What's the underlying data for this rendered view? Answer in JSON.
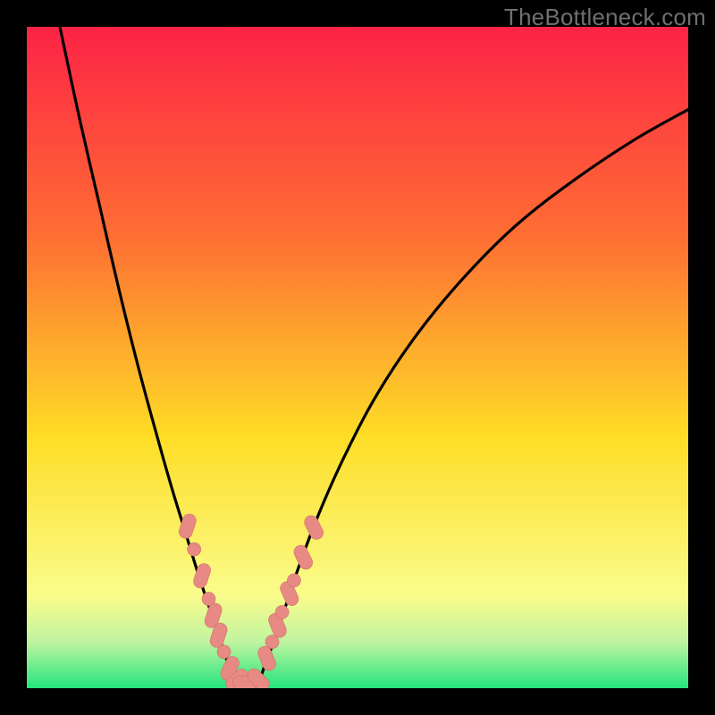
{
  "watermark": "TheBottleneck.com",
  "colors": {
    "gradient_top": "#fd2346",
    "gradient_mid1": "#fe6f33",
    "gradient_mid2": "#fedd26",
    "gradient_mid3": "#fafc8b",
    "gradient_mid4": "#c0f4a0",
    "gradient_bottom": "#23e57d",
    "curve": "#000000",
    "marker_fill": "#e78a83",
    "marker_stroke": "#d06f69"
  },
  "chart_data": {
    "type": "line",
    "title": "",
    "xlabel": "",
    "ylabel": "",
    "xlim": [
      0,
      100
    ],
    "ylim": [
      0,
      100
    ],
    "series": [
      {
        "name": "left-branch",
        "x": [
          5,
          8,
          11,
          14,
          17,
          20,
          22,
          24,
          26,
          28,
          29.5,
          30.5,
          31.5
        ],
        "y": [
          100,
          86,
          73,
          60,
          48,
          37,
          30,
          23.5,
          17,
          11,
          6.5,
          3.5,
          1.2
        ]
      },
      {
        "name": "right-branch",
        "x": [
          35,
          36,
          37.5,
          39,
          41,
          44,
          48,
          53,
          59,
          66,
          74,
          83,
          92,
          100
        ],
        "y": [
          1.2,
          3.5,
          7.5,
          12,
          18,
          26,
          35,
          44.5,
          53.5,
          62,
          70,
          77,
          83,
          87.5
        ]
      },
      {
        "name": "valley-floor",
        "x": [
          31.5,
          33,
          35
        ],
        "y": [
          1.2,
          0.8,
          1.2
        ]
      }
    ],
    "markers_left": [
      {
        "x": 24.3,
        "y": 24.5,
        "shape": "capsule",
        "angle": -72
      },
      {
        "x": 25.3,
        "y": 21.0,
        "shape": "dot"
      },
      {
        "x": 26.5,
        "y": 17.0,
        "shape": "capsule",
        "angle": -72
      },
      {
        "x": 27.5,
        "y": 13.5,
        "shape": "dot"
      },
      {
        "x": 28.2,
        "y": 11.0,
        "shape": "capsule",
        "angle": -72
      },
      {
        "x": 29.0,
        "y": 8.0,
        "shape": "capsule",
        "angle": -72
      },
      {
        "x": 29.8,
        "y": 5.5,
        "shape": "dot"
      },
      {
        "x": 30.7,
        "y": 3.0,
        "shape": "capsule",
        "angle": -65
      },
      {
        "x": 31.8,
        "y": 1.3,
        "shape": "capsule",
        "angle": -40
      }
    ],
    "markers_right": [
      {
        "x": 35.0,
        "y": 1.3,
        "shape": "capsule",
        "angle": 45
      },
      {
        "x": 36.3,
        "y": 4.5,
        "shape": "capsule",
        "angle": 68
      },
      {
        "x": 37.1,
        "y": 7.0,
        "shape": "dot"
      },
      {
        "x": 37.9,
        "y": 9.5,
        "shape": "capsule",
        "angle": 68
      },
      {
        "x": 38.6,
        "y": 11.5,
        "shape": "dot"
      },
      {
        "x": 39.7,
        "y": 14.3,
        "shape": "capsule",
        "angle": 66
      },
      {
        "x": 40.4,
        "y": 16.3,
        "shape": "dot"
      },
      {
        "x": 41.8,
        "y": 19.8,
        "shape": "capsule",
        "angle": 64
      },
      {
        "x": 43.4,
        "y": 24.3,
        "shape": "capsule",
        "angle": 63
      }
    ],
    "markers_floor": [
      {
        "x": 33.0,
        "y": 0.8,
        "shape": "capsule",
        "angle": 0
      }
    ]
  }
}
